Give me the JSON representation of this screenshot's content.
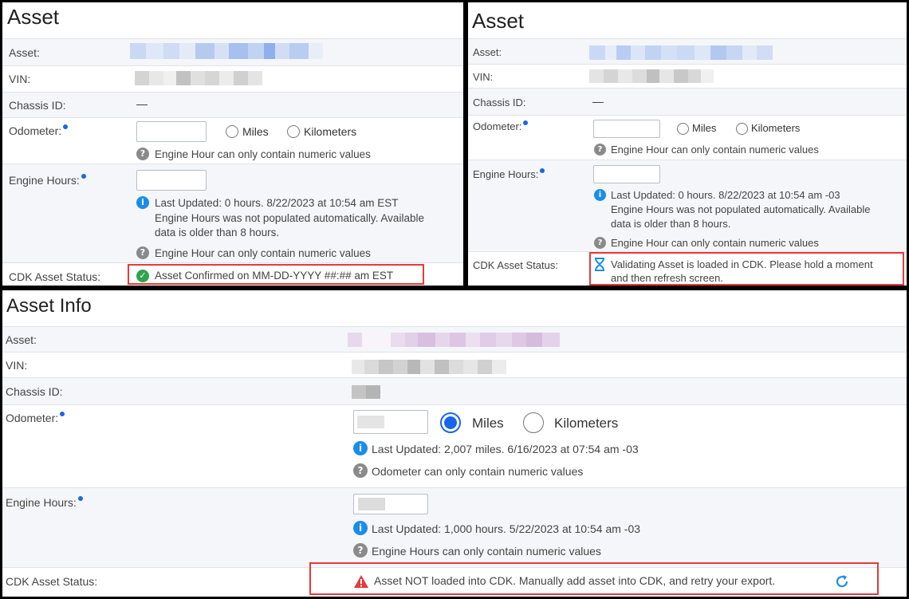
{
  "panel1": {
    "title": "Asset",
    "labels": {
      "asset": "Asset:",
      "vin": "VIN:",
      "chassis": "Chassis ID:",
      "odometer": "Odometer:",
      "engine_hours": "Engine Hours:",
      "cdk_status": "CDK Asset Status:"
    },
    "chassis_value": "—",
    "odometer": {
      "miles_label": "Miles",
      "km_label": "Kilometers",
      "help": "Engine Hour can only contain numeric values"
    },
    "engine_hours": {
      "info_line1": "Last Updated: 0 hours. 8/22/2023 at 10:54 am EST",
      "info_line2": "Engine Hours was not populated automatically. Available",
      "info_line3": "data is older than 8 hours.",
      "help": "Engine Hour can only contain numeric values"
    },
    "cdk_status_text": "Asset Confirmed on MM-DD-YYYY ##:## am EST"
  },
  "panel2": {
    "title": "Asset",
    "labels": {
      "asset": "Asset:",
      "vin": "VIN:",
      "chassis": "Chassis ID:",
      "odometer": "Odometer:",
      "engine_hours": "Engine Hours:",
      "cdk_status": "CDK Asset Status:"
    },
    "chassis_value": "—",
    "odometer": {
      "miles_label": "Miles",
      "km_label": "Kilometers",
      "help": "Engine Hour can only contain numeric values"
    },
    "engine_hours": {
      "info_line1": "Last Updated: 0 hours. 8/22/2023 at 10:54 am -03",
      "info_line2": "Engine Hours was not populated automatically. Available",
      "info_line3": "data is older than 8 hours.",
      "help": "Engine Hour can only contain numeric values"
    },
    "cdk_status_line1": "Validating Asset is loaded in CDK. Please hold a moment",
    "cdk_status_line2": "and then refresh screen."
  },
  "panel3": {
    "title": "Asset Info",
    "labels": {
      "asset": "Asset:",
      "vin": "VIN:",
      "chassis": "Chassis ID:",
      "odometer": "Odometer:",
      "engine_hours": "Engine Hours:",
      "cdk_status": "CDK Asset Status:"
    },
    "odometer": {
      "miles_label": "Miles",
      "km_label": "Kilometers",
      "selected": "Miles",
      "info": "Last Updated: 2,007 miles. 6/16/2023 at 07:54 am -03",
      "help": "Odometer can only contain numeric values"
    },
    "engine_hours": {
      "info": "Last Updated: 1,000 hours. 5/22/2023 at 10:54 am -03",
      "help": "Engine Hours can only contain numeric values"
    },
    "cdk_status_text": "Asset NOT loaded into CDK. Manually add asset into CDK, and retry your export."
  },
  "colors": {
    "required_dot": "#1a66e8",
    "highlight_box": "#e53a3a",
    "success": "#2ea44f",
    "info": "#1a8de8",
    "warning": "#e53a3a"
  },
  "icons": [
    "required-dot-icon",
    "help-icon",
    "info-icon",
    "check-circle-icon",
    "hourglass-icon",
    "warning-triangle-icon",
    "refresh-icon"
  ]
}
